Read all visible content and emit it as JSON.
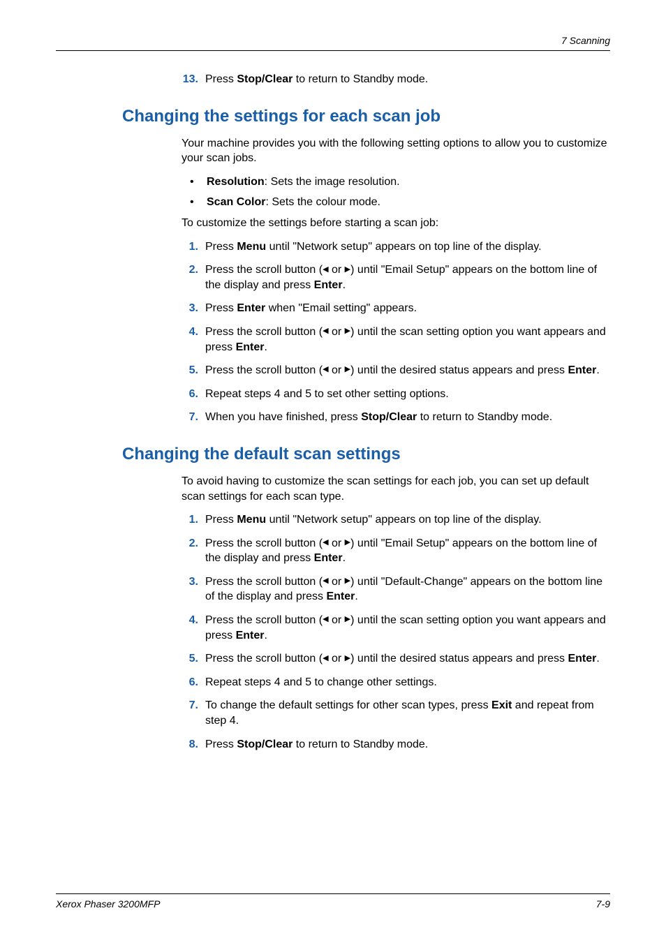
{
  "header": {
    "chapter": "7  Scanning"
  },
  "intro_step": {
    "num": "13.",
    "prefix": "Press ",
    "bold": "Stop/Clear",
    "suffix": " to return to Standby mode."
  },
  "section1": {
    "title": "Changing the settings for each scan job",
    "intro": "Your machine provides you with the following setting options to allow you to customize your scan jobs.",
    "bullets": [
      {
        "bold": "Resolution",
        "rest": ": Sets the image resolution."
      },
      {
        "bold": "Scan Color",
        "rest": ": Sets the colour mode."
      }
    ],
    "lead": "To customize the settings before starting a scan job:",
    "steps": {
      "s1": {
        "num": "1.",
        "a": "Press ",
        "b": "Menu",
        "c": " until \"Network setup\" appears on top line of the display."
      },
      "s2": {
        "num": "2.",
        "a": "Press the scroll button (",
        "mid": " or ",
        "c": ") until \"Email Setup\" appears on the bottom line of the display and press ",
        "d": "Enter",
        "e": "."
      },
      "s3": {
        "num": "3.",
        "a": "Press ",
        "b": "Enter",
        "c": " when \"Email setting\" appears."
      },
      "s4": {
        "num": "4.",
        "a": "Press the scroll button (",
        "mid": " or ",
        "c": ")  until the scan setting option you want appears and press ",
        "d": "Enter",
        "e": "."
      },
      "s5": {
        "num": "5.",
        "a": "Press the scroll button (",
        "mid": " or ",
        "c": ")  until the desired status appears and press ",
        "d": "Enter",
        "e": "."
      },
      "s6": {
        "num": "6.",
        "text": "Repeat steps 4 and 5 to set other setting options."
      },
      "s7": {
        "num": "7.",
        "a": "When you have finished, press ",
        "b": "Stop/Clear",
        "c": " to return to Standby mode."
      }
    }
  },
  "section2": {
    "title": "Changing the default scan settings",
    "intro": "To avoid having to customize the scan settings for each job, you can set up default scan settings for each scan type.",
    "steps": {
      "s1": {
        "num": "1.",
        "a": "Press ",
        "b": "Menu",
        "c": " until \"Network setup\" appears on top line of the display."
      },
      "s2": {
        "num": "2.",
        "a": "Press the scroll button (",
        "mid": " or ",
        "c": ") until \"Email Setup\" appears on the bottom line of the display and press ",
        "d": "Enter",
        "e": "."
      },
      "s3": {
        "num": "3.",
        "a": "Press the scroll button (",
        "mid": " or ",
        "c": ")  until \"Default-Change\" appears on the bottom line of the display and press ",
        "d": "Enter",
        "e": "."
      },
      "s4": {
        "num": "4.",
        "a": "Press the scroll button (",
        "mid": " or ",
        "c": ")  until the scan setting option you want appears and press ",
        "d": "Enter",
        "e": "."
      },
      "s5": {
        "num": "5.",
        "a": "Press the scroll button (",
        "mid": " or ",
        "c": ")  until the desired status appears and press ",
        "d": "Enter",
        "e": "."
      },
      "s6": {
        "num": "6.",
        "text": "Repeat steps 4 and 5 to change other settings."
      },
      "s7": {
        "num": "7.",
        "a": "To change the default settings for other scan types, press ",
        "b": "Exit",
        "c": " and repeat from step 4."
      },
      "s8": {
        "num": "8.",
        "a": "Press ",
        "b": "Stop/Clear",
        "c": " to return to Standby mode."
      }
    }
  },
  "footer": {
    "left": "Xerox Phaser 3200MFP",
    "right": "7-9"
  },
  "icons": {
    "left": "◀",
    "right": "▶"
  }
}
